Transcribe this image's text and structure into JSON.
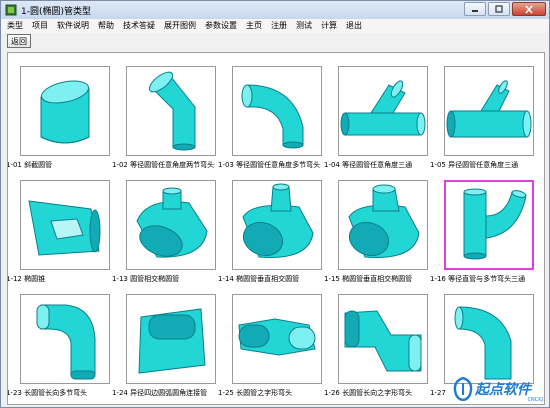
{
  "window": {
    "title": "1-圆(椭圆)管类型"
  },
  "menu": [
    "类型",
    "项目",
    "软件说明",
    "帮助",
    "技术答疑",
    "展开图例",
    "参数设置",
    "主页",
    "注册",
    "测试",
    "计算",
    "退出"
  ],
  "toolbar": {
    "back_label": "返回"
  },
  "tiles": [
    {
      "caption": "1-01  斜截圆管"
    },
    {
      "caption": "1-02  等径圆管任意角度两节弯头"
    },
    {
      "caption": "1-03  等径圆管任意角度多节弯头"
    },
    {
      "caption": "1-04  等径圆管任意角度三通"
    },
    {
      "caption": "1-05  异径圆管任意角度三通"
    },
    {
      "caption": "1-12  椭圆锥"
    },
    {
      "caption": "1-13  圆管相交椭圆管"
    },
    {
      "caption": "1-14  椭圆管垂直相交圆管"
    },
    {
      "caption": "1-15  椭圆管垂直相交椭圆管"
    },
    {
      "caption": "1-16  等径直管与多节弯头三通"
    },
    {
      "caption": "1-23  长圆管长向多节弯头"
    },
    {
      "caption": "1-24  异径四边圆弧圆角连接管"
    },
    {
      "caption": "1-25  长圆管之字形弯头"
    },
    {
      "caption": "1-26  长圆管长向之字形弯头"
    },
    {
      "caption": "1-27  "
    }
  ],
  "selected_tile": 9,
  "watermark": {
    "text": "起点软件",
    "sub": "CNCKJ"
  },
  "colors": {
    "pipe": "#22d6d6",
    "pipe_dark": "#0a7f8a",
    "pipe_shade": "#12aab4",
    "selection": "#e23ee2",
    "watermark": "#1f7bd4"
  }
}
